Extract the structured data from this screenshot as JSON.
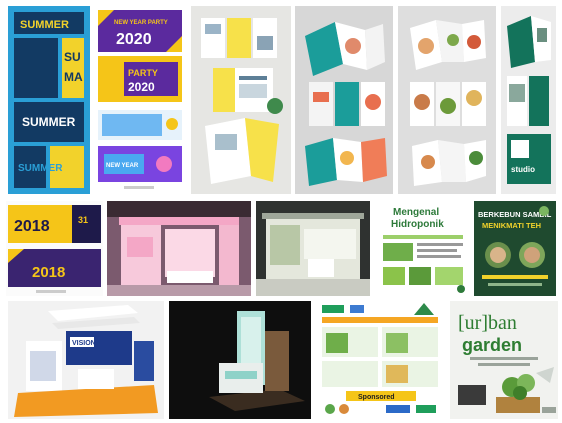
{
  "tiles": [
    {
      "id": "summer-banners",
      "texts": [
        "SUMMER",
        "SUMMER",
        "SUMMER",
        "SU",
        "MA"
      ]
    },
    {
      "id": "party-2020-banners",
      "texts": [
        "NEW YEAR PARTY",
        "2020",
        "PARTY",
        "2020",
        "NEW YEAR"
      ]
    },
    {
      "id": "brochure-yellow",
      "texts": []
    },
    {
      "id": "brochure-teal",
      "texts": []
    },
    {
      "id": "brochure-food",
      "texts": []
    },
    {
      "id": "brochure-green",
      "texts": [
        "studio"
      ]
    },
    {
      "id": "party-2018-banners",
      "texts": [
        "2018",
        "2018",
        "31"
      ]
    },
    {
      "id": "booth-pink",
      "texts": []
    },
    {
      "id": "booth-white",
      "texts": []
    },
    {
      "id": "hidroponik-poster",
      "texts": [
        "Mengenal",
        "Hidroponik"
      ]
    },
    {
      "id": "berkebun-poster",
      "texts": [
        "BERKEBUN SAMBIL",
        "MENIKMATI TEH"
      ]
    },
    {
      "id": "booth-orange",
      "texts": [
        "VISION"
      ]
    },
    {
      "id": "booth-dark",
      "texts": []
    },
    {
      "id": "sponsored-poster",
      "texts": [
        "Sponsored"
      ]
    },
    {
      "id": "urban-garden-poster",
      "texts": [
        "[ur]ban",
        "garden"
      ]
    }
  ],
  "colors": {
    "summer_bg": "#2a9fd6",
    "summer_dark": "#123a63",
    "summer_yellow": "#f2d22b",
    "party_purple": "#5b2a9e",
    "party_yellow": "#f5c518",
    "teal": "#1b9d9a",
    "green": "#13735b",
    "dark_green": "#1e4a2e",
    "pink": "#f4a7c6",
    "orange": "#f29a22"
  }
}
